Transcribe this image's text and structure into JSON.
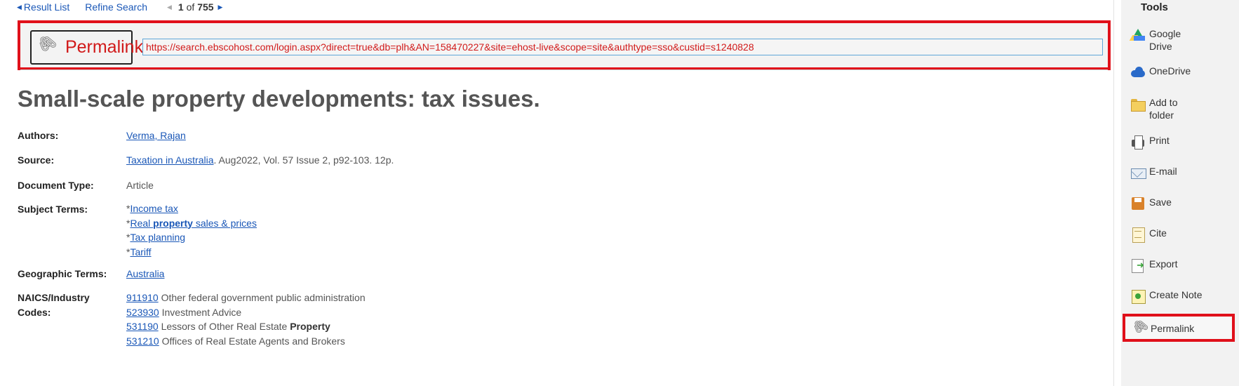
{
  "nav": {
    "result_list": "Result List",
    "refine_search": "Refine Search",
    "position": "1",
    "of": "of",
    "total": "755"
  },
  "permalink": {
    "label": "Permalink",
    "icon": "paperclip-icon",
    "url": "https://search.ebscohost.com/login.aspx?direct=true&db=plh&AN=158470227&site=ehost-live&scope=site&authtype=sso&custid=s1240828"
  },
  "record": {
    "title": "Small-scale property developments: tax issues.",
    "authors": {
      "label": "Authors:",
      "value": "Verma, Rajan"
    },
    "source": {
      "label": "Source:",
      "link": "Taxation in Australia",
      "rest": ". Aug2022, Vol. 57 Issue 2, p92-103. 12p."
    },
    "document_type": {
      "label": "Document Type:",
      "value": "Article"
    },
    "subject_terms": {
      "label": "Subject Terms:",
      "items": [
        {
          "prefix": "*",
          "text": "Income tax"
        },
        {
          "prefix": "*",
          "before": "Real ",
          "bold": "property",
          "after": " sales & prices"
        },
        {
          "prefix": "*",
          "text": "Tax planning"
        },
        {
          "prefix": "*",
          "text": "Tariff"
        }
      ]
    },
    "geographic_terms": {
      "label": "Geographic Terms:",
      "value": "Australia"
    },
    "naics": {
      "label_line1": "NAICS/Industry",
      "label_line2": "Codes:",
      "items": [
        {
          "code": "911910",
          "desc": " Other federal government public administration",
          "bold": ""
        },
        {
          "code": "523930",
          "desc": " Investment Advice",
          "bold": ""
        },
        {
          "code": "531190",
          "desc": " Lessors of Other Real Estate ",
          "bold": "Property"
        },
        {
          "code": "531210",
          "desc": " Offices of Real Estate Agents and Brokers",
          "bold": ""
        }
      ]
    }
  },
  "tools": {
    "heading": "Tools",
    "items": [
      {
        "label_line1": "Google",
        "label_line2": "Drive",
        "icon": "google-drive-icon"
      },
      {
        "label_line1": "OneDrive",
        "label_line2": "",
        "icon": "onedrive-icon"
      },
      {
        "label_line1": "Add to",
        "label_line2": "folder",
        "icon": "folder-icon"
      },
      {
        "label_line1": "Print",
        "label_line2": "",
        "icon": "printer-icon"
      },
      {
        "label_line1": "E-mail",
        "label_line2": "",
        "icon": "envelope-icon"
      },
      {
        "label_line1": "Save",
        "label_line2": "",
        "icon": "save-icon"
      },
      {
        "label_line1": "Cite",
        "label_line2": "",
        "icon": "cite-icon"
      },
      {
        "label_line1": "Export",
        "label_line2": "",
        "icon": "export-icon"
      },
      {
        "label_line1": "Create Note",
        "label_line2": "",
        "icon": "note-icon"
      },
      {
        "label_line1": "Permalink",
        "label_line2": "",
        "icon": "paperclip-icon"
      }
    ]
  },
  "colors": {
    "highlight_border": "#e0101a",
    "link": "#1a57b7",
    "permalink_text": "#d11a1a"
  }
}
